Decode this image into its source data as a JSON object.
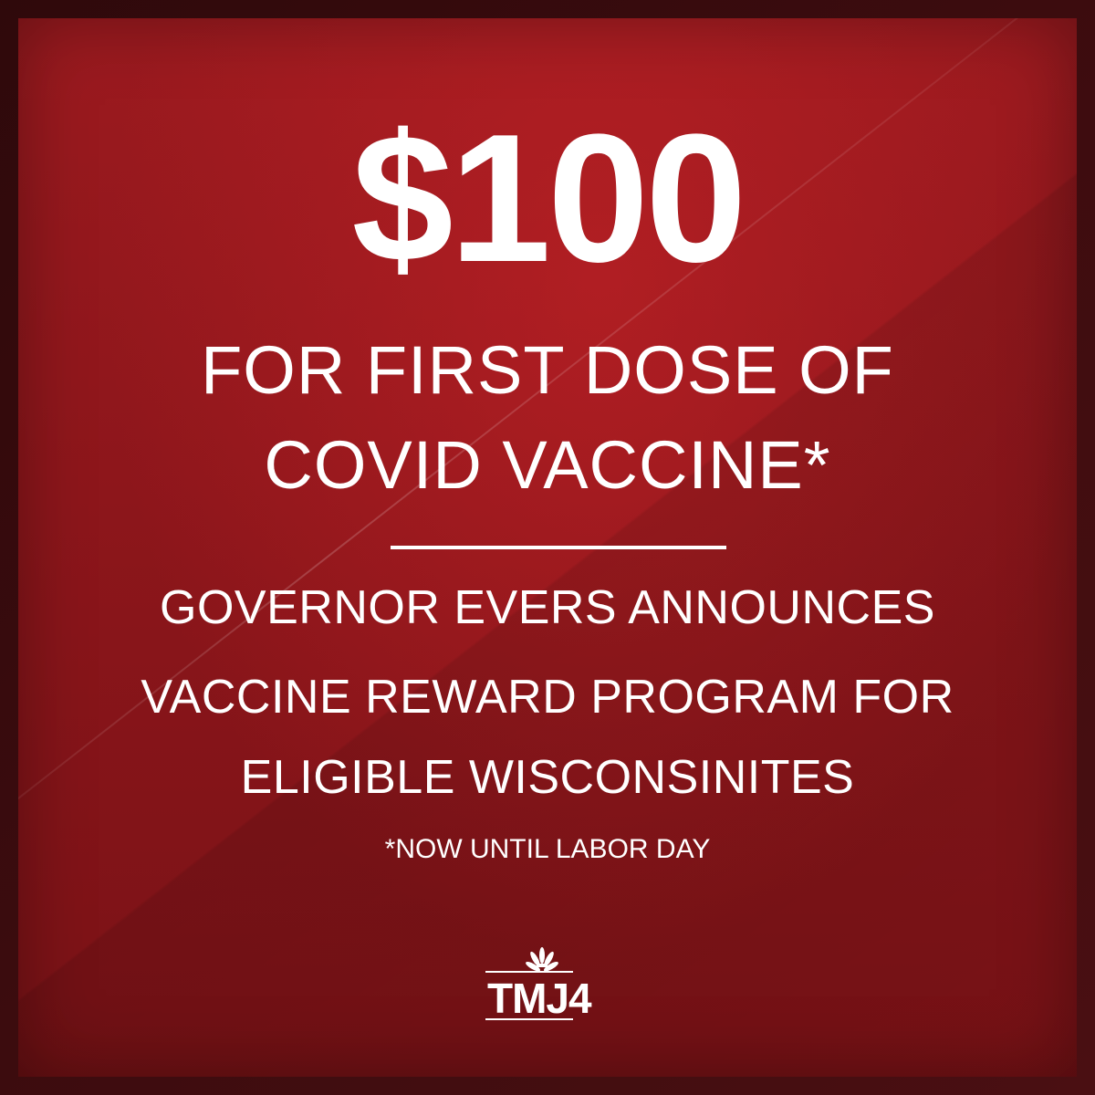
{
  "headline": {
    "amount": "$100",
    "line1": "FOR FIRST DOSE OF",
    "line2": "COVID VACCINE*"
  },
  "body": {
    "lines": [
      "GOVERNOR EVERS ANNOUNCES",
      "VACCINE REWARD PROGRAM FOR",
      "ELIGIBLE WISCONSINITES"
    ]
  },
  "footnote": "*NOW UNTIL LABOR DAY",
  "logo": {
    "text": "TMJ4",
    "icon": "peacock-icon"
  },
  "colors": {
    "background_outer": "#3a0b0d",
    "panel_top": "#9c1a1f",
    "panel_bottom": "#7a1216",
    "text": "#ffffff"
  }
}
